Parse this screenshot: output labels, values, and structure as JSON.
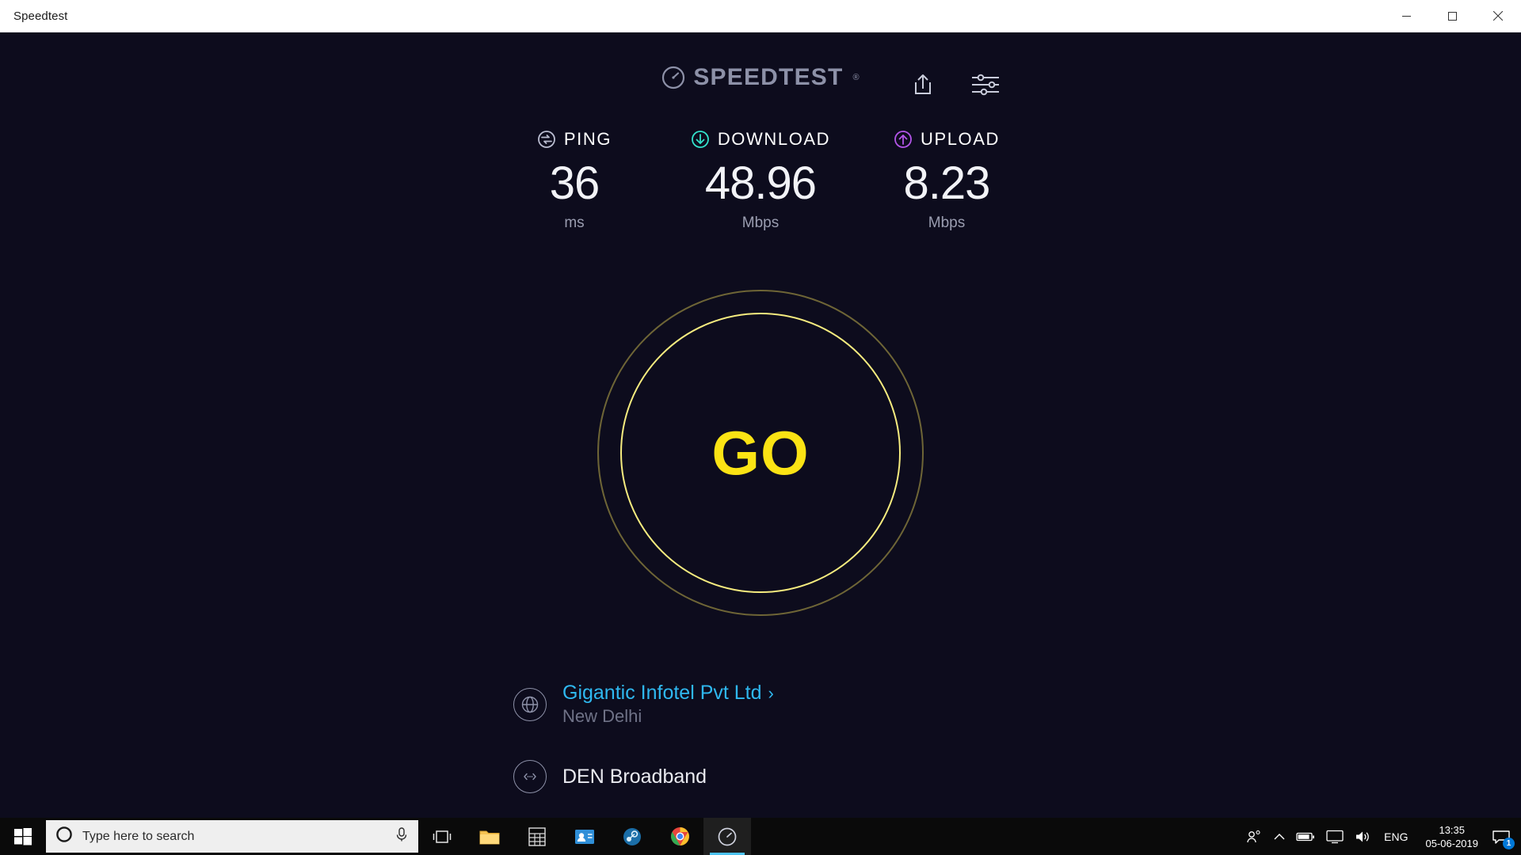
{
  "window": {
    "title": "Speedtest",
    "controls": {
      "minimize": "minimize-button",
      "maximize": "maximize-button",
      "close": "close-button"
    }
  },
  "app": {
    "brand": "SPEEDTEST",
    "trademark": "®",
    "header_icons": [
      "share-icon",
      "settings-sliders-icon"
    ],
    "metrics": [
      {
        "key": "ping",
        "label": "PING",
        "value": "36",
        "unit": "ms",
        "color": "#b9bcd0"
      },
      {
        "key": "download",
        "label": "DOWNLOAD",
        "value": "48.96",
        "unit": "Mbps",
        "color": "#33e2cb"
      },
      {
        "key": "upload",
        "label": "UPLOAD",
        "value": "8.23",
        "unit": "Mbps",
        "color": "#b355e8"
      }
    ],
    "go_button": {
      "label": "GO",
      "ring_outer_color": "#6e6536",
      "ring_inner_color": "#f6ec7f",
      "text_color": "#fbe314"
    },
    "isp": {
      "name": "Gigantic Infotel Pvt Ltd",
      "chevron": "›",
      "city": "New Delhi",
      "link_color": "#2fb8f0"
    },
    "server": {
      "name": "DEN Broadband"
    }
  },
  "taskbar": {
    "search_placeholder": "Type here to search",
    "apps": [
      "task-view",
      "file-explorer",
      "calculator",
      "contacts",
      "steam",
      "google-chrome",
      "speedtest"
    ],
    "active_app": "speedtest",
    "tray": {
      "language": "ENG",
      "time": "13:35",
      "date": "05-06-2019",
      "notification_count": "1"
    }
  }
}
